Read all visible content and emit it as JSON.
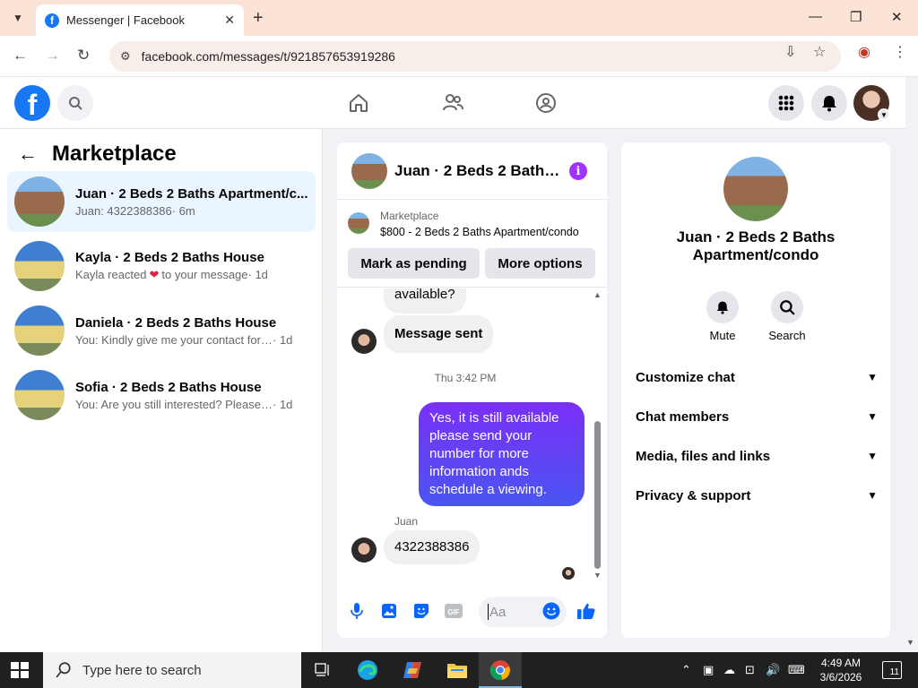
{
  "browser": {
    "tab_title": "Messenger | Facebook",
    "url": "facebook.com/messages/t/921857653919286"
  },
  "sidebar": {
    "title": "Marketplace",
    "conversations": [
      {
        "name": "Juan · 2 Beds 2 Baths Apartment/c...",
        "snippet": "Juan: 4322388386",
        "time": "· 6m",
        "active": true
      },
      {
        "name": "Kayla · 2 Beds 2 Baths House",
        "snippet_before": "Kayla reacted",
        "snippet_after": "to your message",
        "time": "· 1d"
      },
      {
        "name": "Daniela · 2 Beds 2 Baths House",
        "snippet": "You: Kindly give me your contact for ...",
        "time": "· 1d"
      },
      {
        "name": "Sofia · 2 Beds 2 Baths House",
        "snippet": "You: Are you still interested? Please se...",
        "time": "· 1d"
      }
    ]
  },
  "chat": {
    "title": "Juan · 2 Beds 2 Baths Apartment/condo",
    "marketplace_label": "Marketplace",
    "listing": "$800 - 2 Beds 2 Baths Apartment/condo",
    "mark_pending": "Mark as pending",
    "more_options": "More options",
    "messages": {
      "partial": "available?",
      "sent_notice": "Message sent",
      "timestamp": "Thu 3:42 PM",
      "outgoing": "Yes, it is still available please send your number for more information ands schedule a viewing.",
      "sender_name": "Juan",
      "incoming_number": "4322388386"
    },
    "composer_placeholder": "Aa"
  },
  "info_panel": {
    "title": "Juan · 2 Beds 2 Baths Apartment/condo",
    "mute": "Mute",
    "search": "Search",
    "sections": [
      "Customize chat",
      "Chat members",
      "Media, files and links",
      "Privacy & support"
    ]
  },
  "taskbar": {
    "search_placeholder": "Type here to search",
    "time": "4:49 AM",
    "date": "3/6/2026",
    "notification_count": "11"
  },
  "colors": {
    "fb_blue": "#1877f2",
    "messenger_blue": "#0866ff",
    "outgoing_gradient_top": "#7b2ff7",
    "outgoing_gradient_bottom": "#4a55f3",
    "active_conversation": "#ebf5ff",
    "info_icon": "#a033ff"
  }
}
